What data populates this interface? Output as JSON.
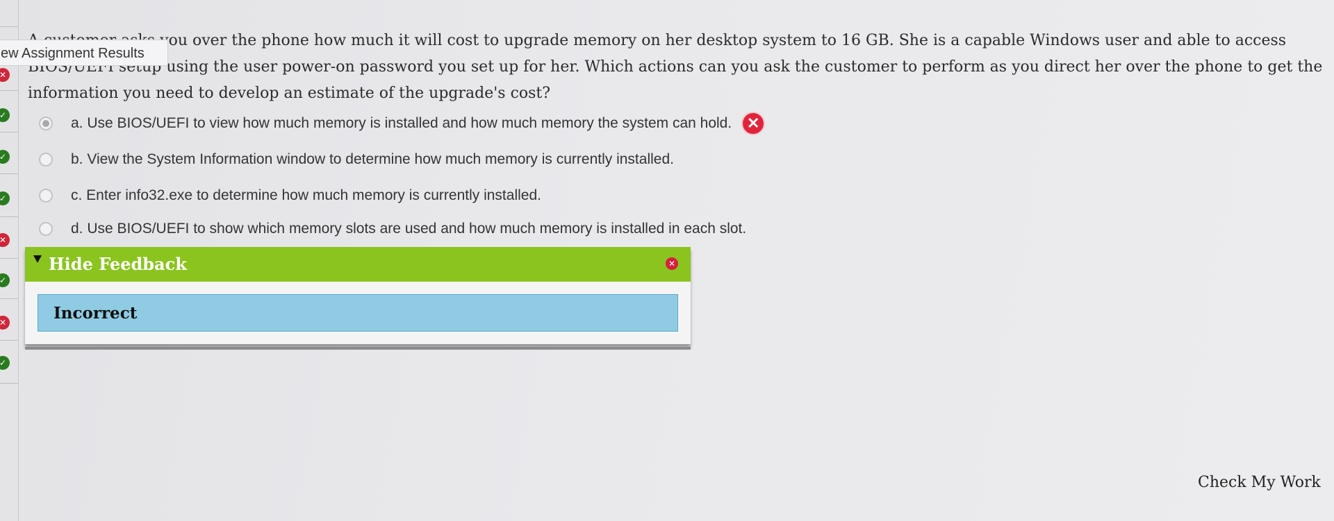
{
  "sidebar": {
    "tooltip": "ew Assignment Results",
    "statuses": [
      {
        "status": "incorrect",
        "glyph": "✕"
      },
      {
        "status": "correct",
        "glyph": "✓"
      },
      {
        "status": "correct",
        "glyph": "✓"
      },
      {
        "status": "correct",
        "glyph": "✓"
      },
      {
        "status": "incorrect",
        "glyph": "✕"
      },
      {
        "status": "correct",
        "glyph": "✓"
      },
      {
        "status": "incorrect",
        "glyph": "✕"
      },
      {
        "status": "correct",
        "glyph": "✓"
      }
    ]
  },
  "question": {
    "line1_start": "A customer asks ",
    "line1_rest": "you over the phone how much it will cost to upgrade memory on her desktop system to 16 GB. She is a capable Windows user and able to access",
    "line2_hidden": "BIOS/UEFI setup",
    "line2_rest": " using the user power-on password you set up for her. Which actions can you ask the customer to perform as you direct her over the phone to get the",
    "line3": "information you need to develop an estimate of the upgrade's cost?"
  },
  "choices": [
    {
      "text": "a. Use BIOS/UEFI to view how much memory is installed and how much memory the system can hold.",
      "selected": true,
      "marked_wrong": true
    },
    {
      "text": "b. View the System Information window to determine how much memory is currently installed.",
      "selected": false,
      "marked_wrong": false
    },
    {
      "text": "c. Enter info32.exe to determine how much memory is currently installed.",
      "selected": false,
      "marked_wrong": false
    },
    {
      "text": "d. Use BIOS/UEFI to show which memory slots are used and how much memory is installed in each slot.",
      "selected": false,
      "marked_wrong": false
    }
  ],
  "feedback": {
    "title": "Hide Feedback",
    "result": "Incorrect",
    "close_glyph": "✕",
    "wrong_glyph": "✕"
  },
  "check_work_label": "Check My Work",
  "colors": {
    "feedback_bar": "#8bc31f",
    "result_box": "#8fcbe3",
    "incorrect_red": "#e1243a",
    "correct_green": "#2a7a1f"
  }
}
